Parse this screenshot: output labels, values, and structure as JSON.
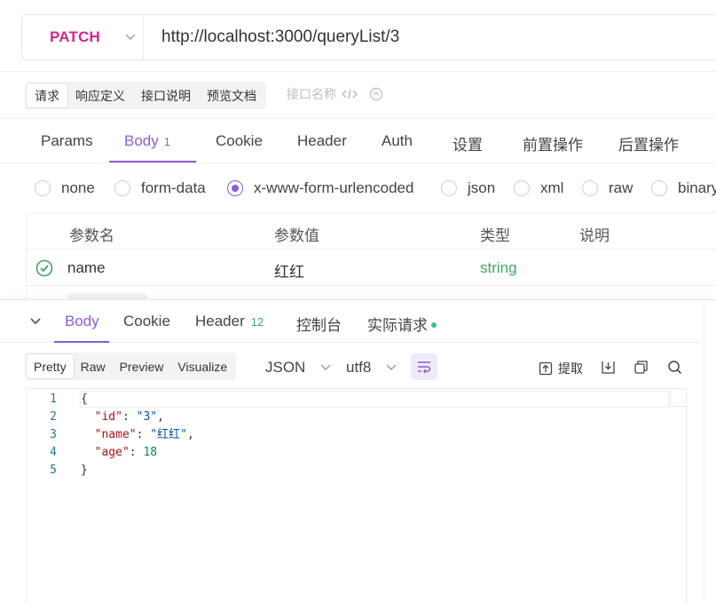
{
  "request": {
    "method": "PATCH",
    "url": "http://localhost:3000/queryList/3"
  },
  "top_tabs": {
    "items": [
      "请求",
      "响应定义",
      "接口说明",
      "预览文档"
    ],
    "active": "请求",
    "name_placeholder": "接口名称"
  },
  "request_tabs": {
    "items": [
      {
        "label": "Params"
      },
      {
        "label": "Body",
        "badge": "1"
      },
      {
        "label": "Cookie"
      },
      {
        "label": "Header"
      },
      {
        "label": "Auth"
      },
      {
        "label": "设置"
      },
      {
        "label": "前置操作"
      },
      {
        "label": "后置操作"
      }
    ],
    "active": "Body"
  },
  "body_types": {
    "items": [
      "none",
      "form-data",
      "x-www-form-urlencoded",
      "json",
      "xml",
      "raw",
      "binary"
    ],
    "selected": "x-www-form-urlencoded"
  },
  "params_table": {
    "headers": [
      "参数名",
      "参数值",
      "类型",
      "说明"
    ],
    "rows": [
      {
        "name": "name",
        "value": "红红",
        "type": "string",
        "desc": "",
        "enabled": true
      }
    ]
  },
  "response": {
    "tabs": [
      {
        "label": "Body"
      },
      {
        "label": "Cookie"
      },
      {
        "label": "Header",
        "badge": "12"
      },
      {
        "label": "控制台"
      },
      {
        "label": "实际请求",
        "dot": true
      }
    ],
    "active": "Body",
    "view_modes": [
      "Pretty",
      "Raw",
      "Preview",
      "Visualize"
    ],
    "active_view": "Pretty",
    "format": "JSON",
    "encoding": "utf8",
    "extract_label": "提取",
    "code_lines": [
      {
        "num": "1",
        "text": "{"
      },
      {
        "num": "2",
        "text": "  \"id\": \"3\","
      },
      {
        "num": "3",
        "text": "  \"name\": \"红红\","
      },
      {
        "num": "4",
        "text": "  \"age\": 18"
      },
      {
        "num": "5",
        "text": "}"
      }
    ]
  },
  "colors": {
    "method": "#d6248f",
    "accent": "#8a5cd6",
    "string_type": "#3ea36b",
    "line_number": "#237893",
    "json_key": "#a31515",
    "json_string": "#0451a5",
    "json_number": "#098658"
  }
}
